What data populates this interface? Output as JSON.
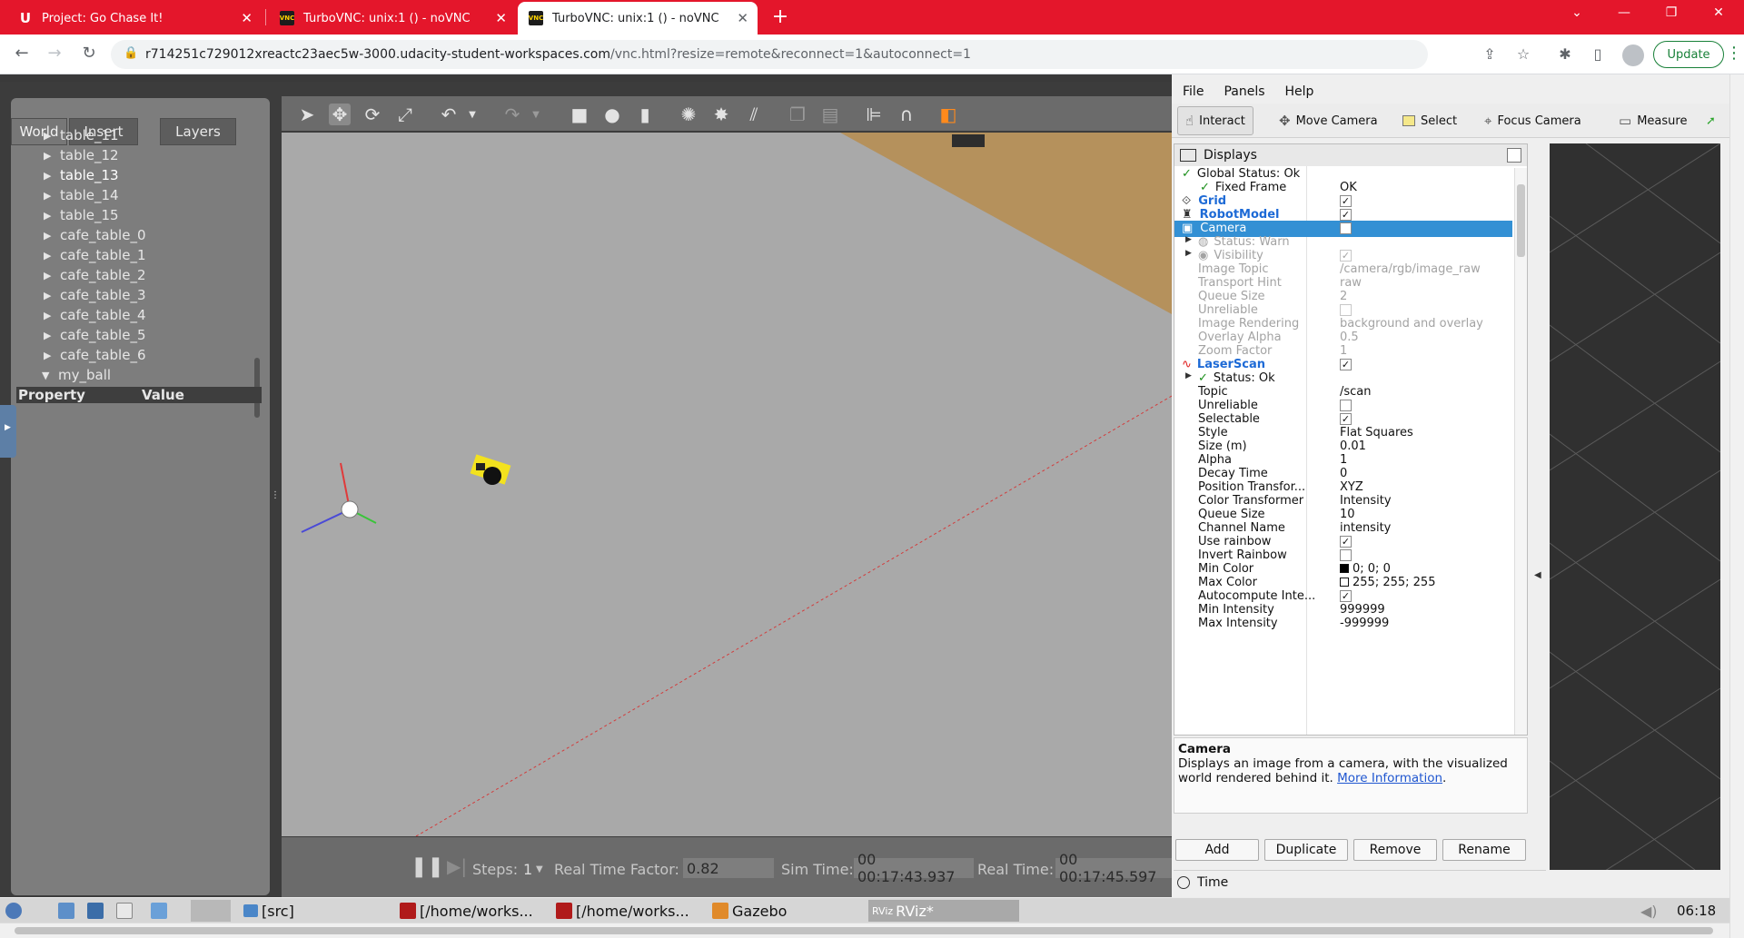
{
  "browser": {
    "tabs": [
      {
        "title": "Project: Go Chase It!",
        "icon": "udacity-icon"
      },
      {
        "title": "TurboVNC: unix:1 () - noVNC",
        "icon": "vnc-icon"
      },
      {
        "title": "TurboVNC: unix:1 () - noVNC",
        "icon": "vnc-icon"
      }
    ],
    "url_host": "r714251c729012xreactc23aec5w-3000.udacity-student-workspaces.com",
    "url_path": "/vnc.html?resize=remote&reconnect=1&autoconnect=1",
    "update_label": "Update"
  },
  "gazebo": {
    "tabs": [
      "World",
      "Insert",
      "Layers"
    ],
    "tree": [
      {
        "label": "table_11"
      },
      {
        "label": "table_12"
      },
      {
        "label": "table_13"
      },
      {
        "label": "table_14"
      },
      {
        "label": "table_15"
      },
      {
        "label": "cafe_table_0"
      },
      {
        "label": "cafe_table_1"
      },
      {
        "label": "cafe_table_2"
      },
      {
        "label": "cafe_table_3"
      },
      {
        "label": "cafe_table_4"
      },
      {
        "label": "cafe_table_5"
      },
      {
        "label": "cafe_table_6"
      },
      {
        "label": "my_ball"
      }
    ],
    "property_header": "Property",
    "value_header": "Value",
    "steps_label": "Steps:",
    "steps_value": "1",
    "rtf_label": "Real Time Factor:",
    "rtf_value": "0.82",
    "sim_time_label": "Sim Time:",
    "sim_time_value": "00 00:17:43.937",
    "real_time_label": "Real Time:",
    "real_time_value": "00 00:17:45.597"
  },
  "rviz": {
    "menu": [
      "File",
      "Panels",
      "Help"
    ],
    "tools": [
      "Interact",
      "Move Camera",
      "Select",
      "Focus Camera",
      "Measure"
    ],
    "displays_title": "Displays",
    "description_title": "Camera",
    "description_text": "Displays an image from a camera, with the visualized world rendered behind it.",
    "description_link": "More Information",
    "buttons": [
      "Add",
      "Duplicate",
      "Remove",
      "Rename"
    ],
    "time_label": "Time",
    "rows": [
      {
        "name": "Global Status: Ok",
        "value": "",
        "check": false
      },
      {
        "name": "Fixed Frame",
        "value": "OK",
        "check": false
      },
      {
        "name": "Grid",
        "value": "",
        "check": true
      },
      {
        "name": "RobotModel",
        "value": "",
        "check": true
      },
      {
        "name": "Camera",
        "value": "",
        "check": false
      },
      {
        "name": "Status: Warn",
        "value": "",
        "check": false
      },
      {
        "name": "Visibility",
        "value": "",
        "check": true
      },
      {
        "name": "Image Topic",
        "value": "/camera/rgb/image_raw",
        "check": false
      },
      {
        "name": "Transport Hint",
        "value": "raw",
        "check": false
      },
      {
        "name": "Queue Size",
        "value": "2",
        "check": false
      },
      {
        "name": "Unreliable",
        "value": "",
        "check": false
      },
      {
        "name": "Image Rendering",
        "value": "background and overlay",
        "check": false
      },
      {
        "name": "Overlay Alpha",
        "value": "0.5",
        "check": false
      },
      {
        "name": "Zoom Factor",
        "value": "1",
        "check": false
      },
      {
        "name": "LaserScan",
        "value": "",
        "check": true
      },
      {
        "name": "Status: Ok",
        "value": "",
        "check": false
      },
      {
        "name": "Topic",
        "value": "/scan",
        "check": false
      },
      {
        "name": "Unreliable",
        "value": "",
        "check": false
      },
      {
        "name": "Selectable",
        "value": "",
        "check": true
      },
      {
        "name": "Style",
        "value": "Flat Squares",
        "check": false
      },
      {
        "name": "Size (m)",
        "value": "0.01",
        "check": false
      },
      {
        "name": "Alpha",
        "value": "1",
        "check": false
      },
      {
        "name": "Decay Time",
        "value": "0",
        "check": false
      },
      {
        "name": "Position Transfor...",
        "value": "XYZ",
        "check": false
      },
      {
        "name": "Color Transformer",
        "value": "Intensity",
        "check": false
      },
      {
        "name": "Queue Size",
        "value": "10",
        "check": false
      },
      {
        "name": "Channel Name",
        "value": "intensity",
        "check": false
      },
      {
        "name": "Use rainbow",
        "value": "",
        "check": true
      },
      {
        "name": "Invert Rainbow",
        "value": "",
        "check": false
      },
      {
        "name": "Min Color",
        "value": "0; 0; 0",
        "check": false
      },
      {
        "name": "Max Color",
        "value": "255; 255; 255",
        "check": false
      },
      {
        "name": "Autocompute Inte...",
        "value": "",
        "check": true
      },
      {
        "name": "Min Intensity",
        "value": "999999",
        "check": false
      },
      {
        "name": "Max Intensity",
        "value": "-999999",
        "check": false
      }
    ]
  },
  "taskbar": {
    "items": [
      "[src]",
      "[/home/works...",
      "[/home/works...",
      "Gazebo",
      "RViz*"
    ],
    "clock": "06:18"
  },
  "colors": {
    "tab_bar": "#e4162b",
    "gazebo_panel": "#7d7d7d",
    "scene_floor": "#a9a9a9",
    "rviz_selection": "#3390d4",
    "rviz_link": "#1d6ad6"
  }
}
